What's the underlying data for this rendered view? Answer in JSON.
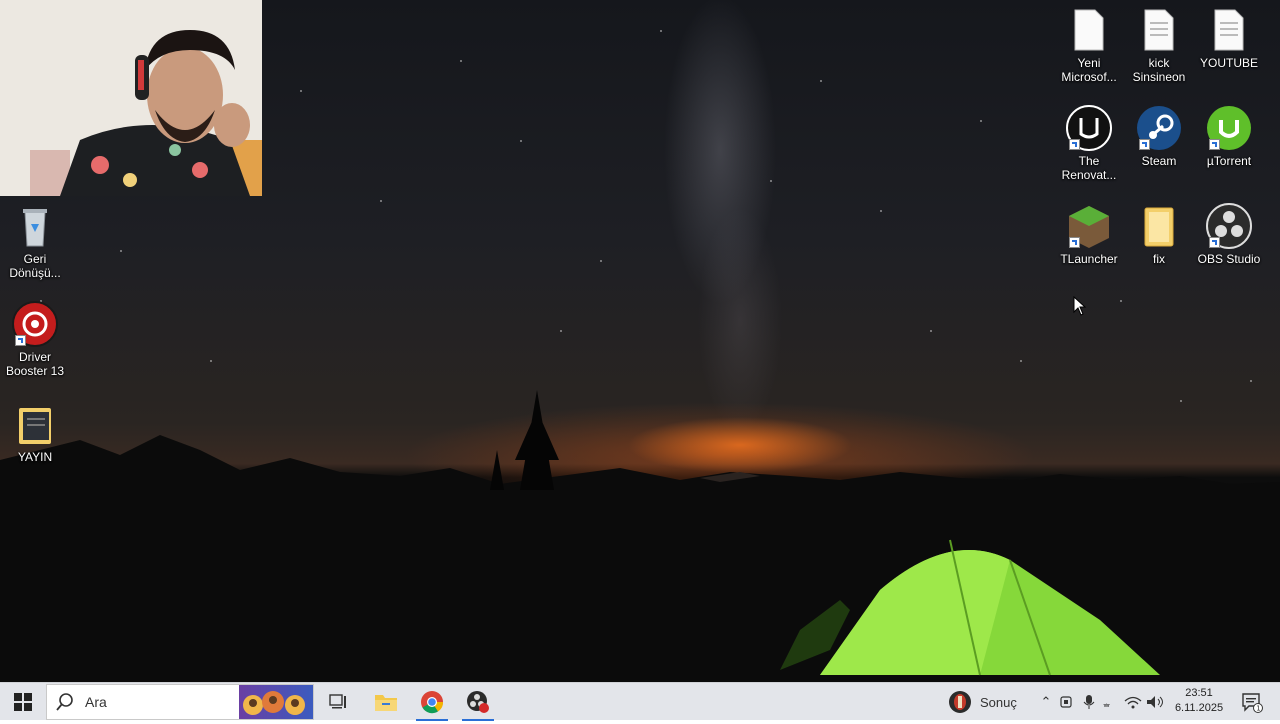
{
  "desktop": {
    "left_icons": [
      {
        "name": "recycle-bin",
        "label": "Geri\nDönüşü..."
      },
      {
        "name": "driver-booster",
        "label": "Driver\nBooster 13"
      },
      {
        "name": "yayin-folder",
        "label": "YAYIN"
      }
    ],
    "right_icons": [
      {
        "name": "yeni-microsoft",
        "label": "Yeni\nMicrosof..."
      },
      {
        "name": "kick-sinsineon",
        "label": "kick\nSinsineon"
      },
      {
        "name": "youtube-file",
        "label": "YOUTUBE"
      },
      {
        "name": "the-renovators",
        "label": "The\nRenovat..."
      },
      {
        "name": "steam",
        "label": "Steam"
      },
      {
        "name": "utorrent",
        "label": "µTorrent"
      },
      {
        "name": "tlauncher",
        "label": "TLauncher"
      },
      {
        "name": "fix-folder",
        "label": "fix"
      },
      {
        "name": "obs-studio",
        "label": "OBS Studio"
      }
    ]
  },
  "taskbar": {
    "search_placeholder": "Ara",
    "weather_label": "Sonuç",
    "clock_time": "23:51",
    "clock_date": "6.11.2025",
    "notification_count": "1"
  },
  "colors": {
    "taskbar_bg": "#e3e5ea",
    "accent_blue": "#2a6fd6",
    "tent_green": "#8fe23a"
  }
}
